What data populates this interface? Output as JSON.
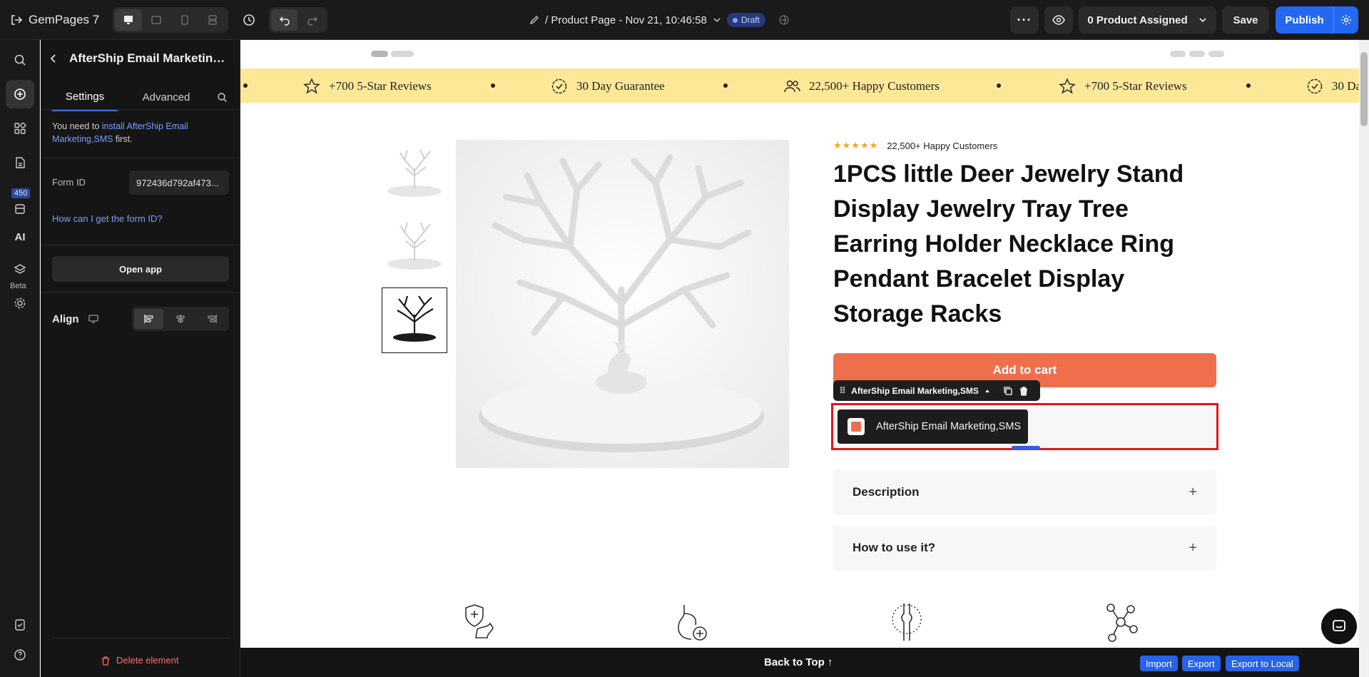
{
  "topbar": {
    "app_name": "GemPages 7",
    "page_title": "/ Product Page - Nov 21, 10:46:58",
    "status_badge": "Draft",
    "assigned_label": "0 Product Assigned",
    "save_label": "Save",
    "publish_label": "Publish"
  },
  "rail": {
    "badge_count": "450",
    "ai_label": "AI",
    "beta_label": "Beta"
  },
  "panel": {
    "title": "AfterShip Email Marketing,S...",
    "tabs": [
      "Settings",
      "Advanced"
    ],
    "notice_prefix": "You need to ",
    "notice_link": "install AfterShip Email Marketing,SMS",
    "notice_suffix": " first.",
    "form_id_label": "Form ID",
    "form_id_value": "972436d792af473...",
    "help_link": "How can I get the form ID?",
    "open_app_label": "Open app",
    "align_label": "Align",
    "delete_label": "Delete element"
  },
  "canvas": {
    "marquee": [
      "+700 5-Star Reviews",
      "30 Day Guarantee",
      "22,500+ Happy Customers",
      "+700 5-Star Reviews",
      "30 Da"
    ],
    "rating_stars": "★★★★★",
    "rating_text": "22,500+ Happy Customers",
    "product_title": "1PCS little Deer Jewelry Stand Display Jewelry Tray Tree Earring Holder Necklace Ring Pendant Bracelet Display Storage Racks",
    "add_to_cart": "Add to cart",
    "selected_element_label": "AfterShip Email Marketing,SMS",
    "aftership_button_label": "AfterShip Email Marketing,SMS",
    "accordions": [
      "Description",
      "How to use it?"
    ]
  },
  "bottombar": {
    "back_to_top": "Back to Top ↑",
    "import_label": "Import",
    "export_label": "Export",
    "export_local_label": "Export to Local"
  },
  "colors": {
    "accent_blue": "#2468f2",
    "add_cart_orange": "#ef6f4c",
    "marquee_yellow": "#fde898",
    "selection_red": "#e5141d"
  }
}
